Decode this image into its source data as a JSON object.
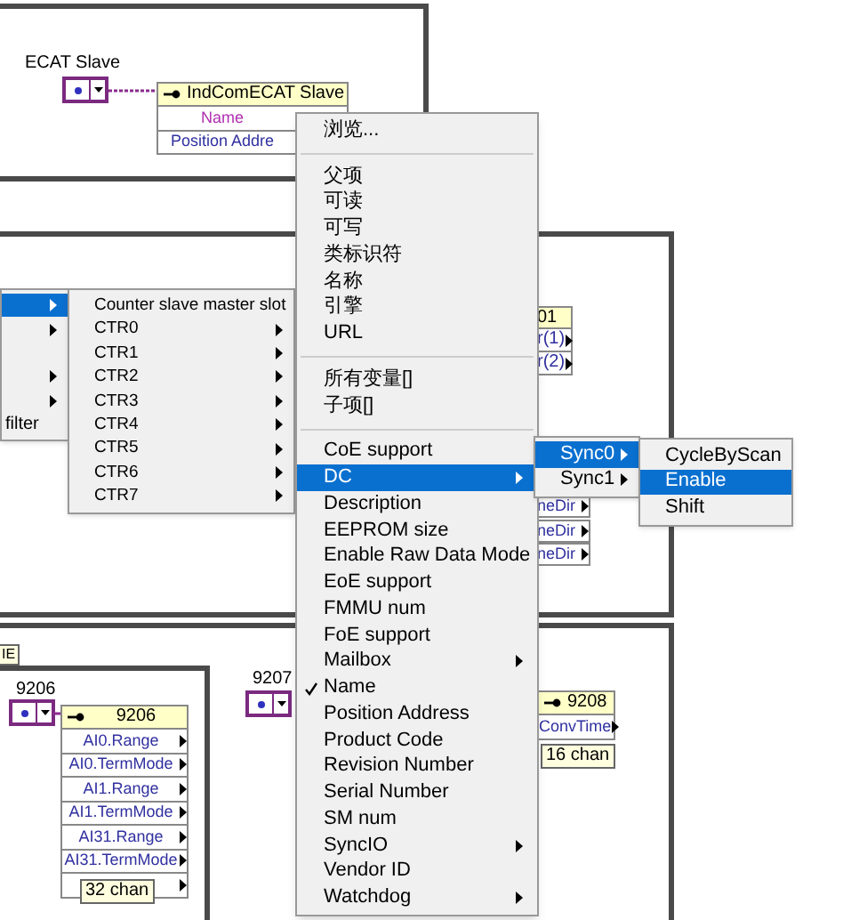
{
  "ecat_slave": {
    "label": "ECAT Slave",
    "node": {
      "title": "IndComECAT Slave",
      "rows": [
        {
          "text": "Name",
          "color": "#b030b0"
        },
        {
          "text": "Position Addre",
          "color": "#3030a0"
        }
      ]
    }
  },
  "left_menu": {
    "items": [
      {
        "has_submenu": true,
        "selected": true
      },
      {
        "has_submenu": true,
        "selected": false
      },
      {
        "has_submenu": false,
        "selected": false
      },
      {
        "has_submenu": true,
        "selected": false
      },
      {
        "has_submenu": true,
        "selected": false
      },
      {
        "label": "filter",
        "has_submenu": false,
        "selected": false
      }
    ]
  },
  "ctr_menu": {
    "items": [
      {
        "label": "Counter slave master slot",
        "has_submenu": false,
        "selected": false
      },
      {
        "label": "CTR0",
        "has_submenu": true,
        "selected": false
      },
      {
        "label": "CTR1",
        "has_submenu": true,
        "selected": false
      },
      {
        "label": "CTR2",
        "has_submenu": true,
        "selected": false
      },
      {
        "label": "CTR3",
        "has_submenu": true,
        "selected": false
      },
      {
        "label": "CTR4",
        "has_submenu": true,
        "selected": false
      },
      {
        "label": "CTR5",
        "has_submenu": true,
        "selected": false
      },
      {
        "label": "CTR6",
        "has_submenu": true,
        "selected": false
      },
      {
        "label": "CTR7",
        "has_submenu": true,
        "selected": false
      }
    ]
  },
  "context_menu": {
    "items": [
      {
        "kind": "item",
        "label": "浏览...",
        "has_submenu": false,
        "checked": false,
        "selected": false
      },
      {
        "kind": "separator"
      },
      {
        "kind": "item",
        "label": "父项",
        "has_submenu": false,
        "checked": false,
        "selected": false
      },
      {
        "kind": "item",
        "label": "可读",
        "has_submenu": false,
        "checked": false,
        "selected": false
      },
      {
        "kind": "item",
        "label": "可写",
        "has_submenu": false,
        "checked": false,
        "selected": false
      },
      {
        "kind": "item",
        "label": "类标识符",
        "has_submenu": false,
        "checked": false,
        "selected": false
      },
      {
        "kind": "item",
        "label": "名称",
        "has_submenu": false,
        "checked": false,
        "selected": false
      },
      {
        "kind": "item",
        "label": "引擎",
        "has_submenu": false,
        "checked": false,
        "selected": false
      },
      {
        "kind": "item",
        "label": "URL",
        "has_submenu": false,
        "checked": false,
        "selected": false
      },
      {
        "kind": "separator"
      },
      {
        "kind": "item",
        "label": "所有变量[]",
        "has_submenu": false,
        "checked": false,
        "selected": false
      },
      {
        "kind": "item",
        "label": "子项[]",
        "has_submenu": false,
        "checked": false,
        "selected": false
      },
      {
        "kind": "separator"
      },
      {
        "kind": "item",
        "label": "CoE support",
        "has_submenu": false,
        "checked": false,
        "selected": false
      },
      {
        "kind": "item",
        "label": "DC",
        "has_submenu": true,
        "checked": false,
        "selected": true
      },
      {
        "kind": "item",
        "label": "Description",
        "has_submenu": false,
        "checked": false,
        "selected": false
      },
      {
        "kind": "item",
        "label": "EEPROM size",
        "has_submenu": false,
        "checked": false,
        "selected": false
      },
      {
        "kind": "item",
        "label": "Enable Raw Data Mode",
        "has_submenu": false,
        "checked": false,
        "selected": false
      },
      {
        "kind": "item",
        "label": "EoE support",
        "has_submenu": false,
        "checked": false,
        "selected": false
      },
      {
        "kind": "item",
        "label": "FMMU num",
        "has_submenu": false,
        "checked": false,
        "selected": false
      },
      {
        "kind": "item",
        "label": "FoE support",
        "has_submenu": false,
        "checked": false,
        "selected": false
      },
      {
        "kind": "item",
        "label": "Mailbox",
        "has_submenu": true,
        "checked": false,
        "selected": false
      },
      {
        "kind": "item",
        "label": "Name",
        "has_submenu": false,
        "checked": true,
        "selected": false
      },
      {
        "kind": "item",
        "label": "Position Address",
        "has_submenu": false,
        "checked": false,
        "selected": false
      },
      {
        "kind": "item",
        "label": "Product Code",
        "has_submenu": false,
        "checked": false,
        "selected": false
      },
      {
        "kind": "item",
        "label": "Revision Number",
        "has_submenu": false,
        "checked": false,
        "selected": false
      },
      {
        "kind": "item",
        "label": "Serial Number",
        "has_submenu": false,
        "checked": false,
        "selected": false
      },
      {
        "kind": "item",
        "label": "SM num",
        "has_submenu": false,
        "checked": false,
        "selected": false
      },
      {
        "kind": "item",
        "label": "SyncIO",
        "has_submenu": true,
        "checked": false,
        "selected": false
      },
      {
        "kind": "item",
        "label": "Vendor ID",
        "has_submenu": false,
        "checked": false,
        "selected": false
      },
      {
        "kind": "item",
        "label": "Watchdog",
        "has_submenu": true,
        "checked": false,
        "selected": false
      }
    ]
  },
  "dc_menu": {
    "items": [
      {
        "label": "Sync0",
        "has_submenu": true,
        "selected": true
      },
      {
        "label": "Sync1",
        "has_submenu": true,
        "selected": false
      }
    ]
  },
  "sync0_menu": {
    "items": [
      {
        "label": "CycleByScan",
        "selected": false
      },
      {
        "label": "Enable",
        "selected": true
      },
      {
        "label": "Shift",
        "selected": false
      }
    ]
  },
  "right_fragments": {
    "header": "01",
    "rows": [
      "r(1)",
      "r(2)"
    ],
    "dir_rows": [
      "neDir",
      "neDir",
      "neDir"
    ]
  },
  "tab_label": "IE",
  "node_9206": {
    "label": "9206",
    "title": "9206",
    "rows": [
      {
        "text": "AI0.Range",
        "color": "#3030a0"
      },
      {
        "text": "AI0.TermMode",
        "color": "#3030a0"
      },
      {
        "text": "AI1.Range",
        "color": "#3030a0"
      },
      {
        "text": "AI1.TermMode",
        "color": "#3030a0"
      },
      {
        "text": "AI31.Range",
        "color": "#3030a0"
      },
      {
        "text": "AI31.TermMode",
        "color": "#3030a0"
      },
      {}
    ],
    "channels": "32 chan"
  },
  "node_9207": {
    "label": "9207"
  },
  "node_9208": {
    "title": "9208",
    "rows": [
      {
        "text": "ConvTime",
        "color": "#3030a0"
      }
    ],
    "channels": "16 chan"
  }
}
